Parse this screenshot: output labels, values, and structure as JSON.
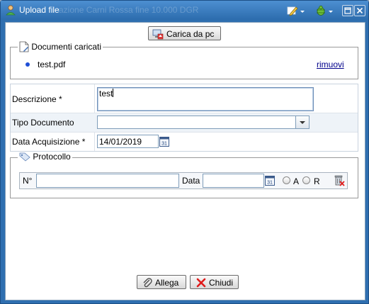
{
  "window": {
    "title": "Upload file",
    "ghost_title": "azione Carni Rossa fine 10.000 DGR",
    "icon": "user-upload-icon"
  },
  "toolbar": {
    "edit_icon": "pencil-edit-icon",
    "bug_icon": "bug-icon"
  },
  "upload": {
    "button_label": "Carica da pc"
  },
  "documents": {
    "legend": "Documenti caricati",
    "items": [
      {
        "name": "test.pdf",
        "remove_label": "rimuovi"
      }
    ]
  },
  "form": {
    "descrizione_label": "Descrizione *",
    "descrizione_value": "test",
    "tipo_label": "Tipo Documento",
    "tipo_value": "",
    "data_label": "Data Acquisizione *",
    "data_value": "14/01/2019"
  },
  "protocollo": {
    "legend": "Protocollo",
    "numero_label": "N°",
    "numero_value": "",
    "data_label": "Data",
    "data_value": "",
    "option_a": "A",
    "option_r": "R"
  },
  "footer": {
    "allega_label": "Allega",
    "chiudi_label": "Chiudi"
  },
  "colors": {
    "titlebar": "#2f6fb0",
    "link": "#00008b",
    "border": "#7f9db9"
  }
}
